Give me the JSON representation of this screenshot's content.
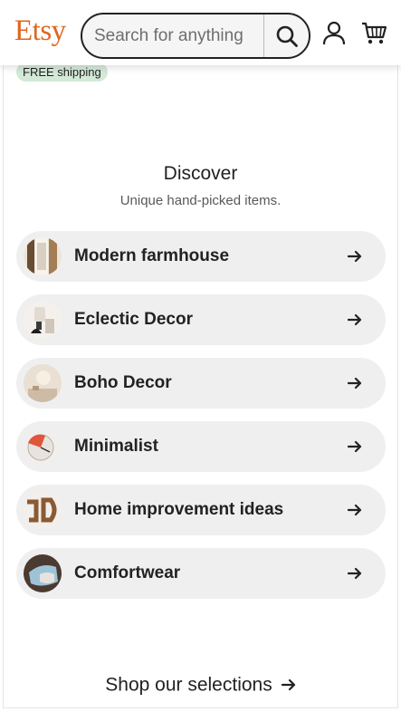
{
  "header": {
    "logo": "Etsy",
    "search_placeholder": "Search for anything",
    "icons": [
      "search-icon",
      "user-icon",
      "cart-icon"
    ]
  },
  "badge": "FREE shipping",
  "discover": {
    "title": "Discover",
    "subtitle": "Unique hand-picked items."
  },
  "items": [
    {
      "label": "Modern farmhouse"
    },
    {
      "label": "Eclectic Decor"
    },
    {
      "label": "Boho Decor"
    },
    {
      "label": "Minimalist"
    },
    {
      "label": "Home improvement ideas"
    },
    {
      "label": "Comfortwear"
    }
  ],
  "shop": {
    "label": "Shop our selections"
  },
  "colors": {
    "brand": "#e0651e",
    "badge_bg": "#d4e9d7",
    "pill_bg": "#efefef"
  }
}
